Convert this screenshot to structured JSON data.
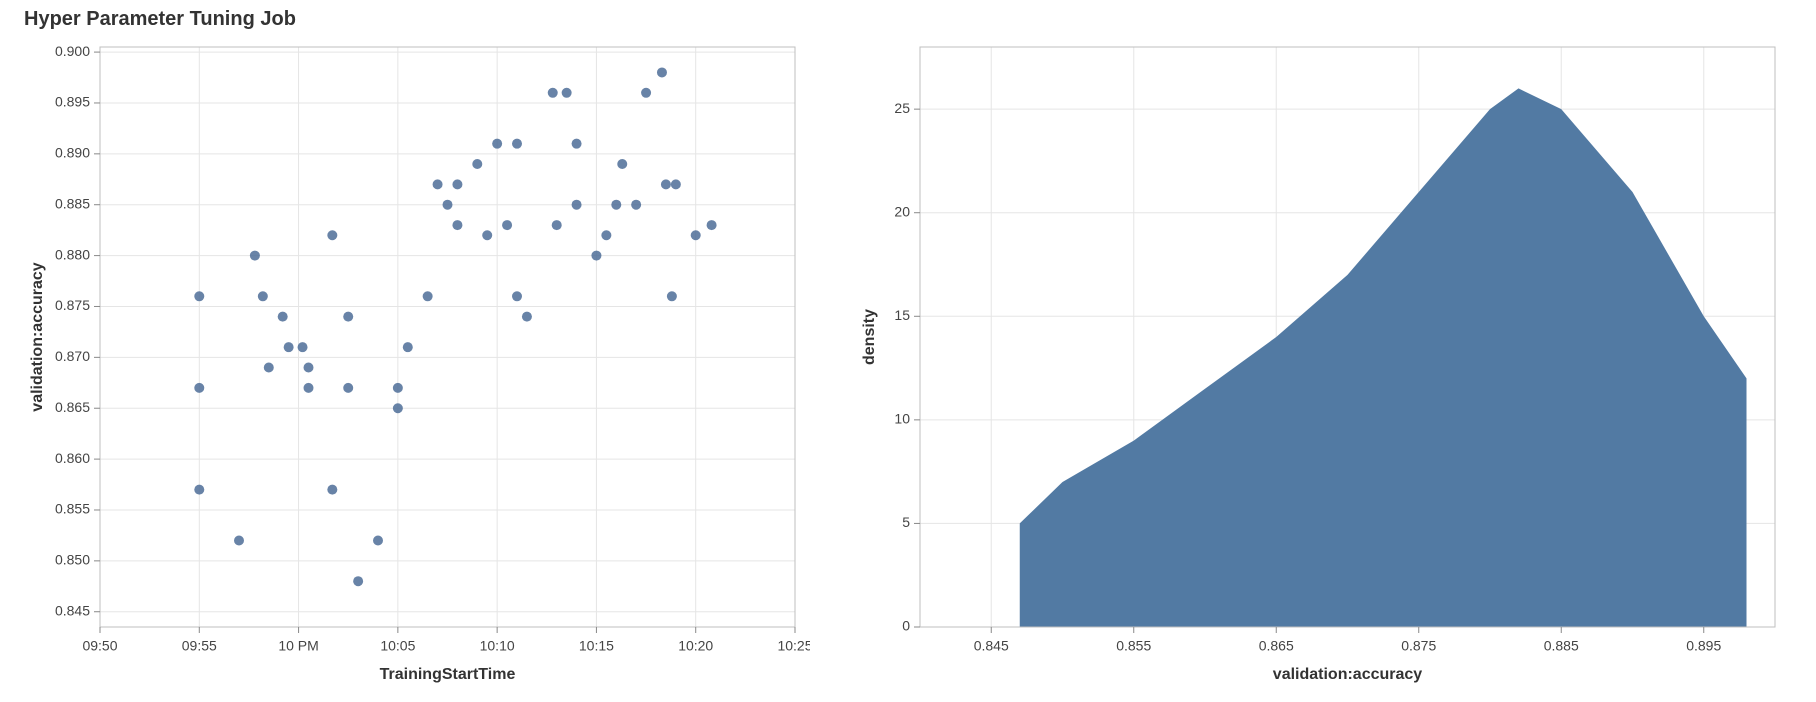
{
  "title": "Hyper Parameter Tuning Job",
  "colors": {
    "accent": "#527aa3",
    "dot": "#4d6d98"
  },
  "chart_data": [
    {
      "type": "scatter",
      "title": "Hyper Parameter Tuning Job",
      "xlabel": "TrainingStartTime",
      "ylabel": "validation:accuracy",
      "x_ticks_labels": [
        "09:50",
        "09:55",
        "10 PM",
        "10:05",
        "10:10",
        "10:15",
        "10:20",
        "10:25"
      ],
      "x_ticks_minutes": [
        -10,
        -5,
        0,
        5,
        10,
        15,
        20,
        25
      ],
      "xlim_minutes": [
        -10,
        25
      ],
      "y_ticks": [
        0.845,
        0.85,
        0.855,
        0.86,
        0.865,
        0.87,
        0.875,
        0.88,
        0.885,
        0.89,
        0.895,
        0.9
      ],
      "ylim": [
        0.8435,
        0.9005
      ],
      "points": [
        {
          "t": -5.0,
          "y": 0.876
        },
        {
          "t": -5.0,
          "y": 0.867
        },
        {
          "t": -5.0,
          "y": 0.857
        },
        {
          "t": -3.0,
          "y": 0.852
        },
        {
          "t": -2.2,
          "y": 0.88
        },
        {
          "t": -1.8,
          "y": 0.876
        },
        {
          "t": -1.5,
          "y": 0.869
        },
        {
          "t": -0.8,
          "y": 0.874
        },
        {
          "t": -0.5,
          "y": 0.871
        },
        {
          "t": 0.2,
          "y": 0.871
        },
        {
          "t": 0.5,
          "y": 0.867
        },
        {
          "t": 0.5,
          "y": 0.869
        },
        {
          "t": 1.7,
          "y": 0.882
        },
        {
          "t": 1.7,
          "y": 0.857
        },
        {
          "t": 2.5,
          "y": 0.867
        },
        {
          "t": 2.5,
          "y": 0.874
        },
        {
          "t": 3.0,
          "y": 0.848
        },
        {
          "t": 4.0,
          "y": 0.852
        },
        {
          "t": 5.0,
          "y": 0.867
        },
        {
          "t": 5.0,
          "y": 0.865
        },
        {
          "t": 5.5,
          "y": 0.871
        },
        {
          "t": 6.5,
          "y": 0.876
        },
        {
          "t": 7.0,
          "y": 0.887
        },
        {
          "t": 7.5,
          "y": 0.885
        },
        {
          "t": 8.0,
          "y": 0.887
        },
        {
          "t": 8.0,
          "y": 0.883
        },
        {
          "t": 9.0,
          "y": 0.889
        },
        {
          "t": 9.5,
          "y": 0.882
        },
        {
          "t": 10.0,
          "y": 0.891
        },
        {
          "t": 10.5,
          "y": 0.883
        },
        {
          "t": 11.0,
          "y": 0.891
        },
        {
          "t": 11.0,
          "y": 0.876
        },
        {
          "t": 11.5,
          "y": 0.874
        },
        {
          "t": 12.8,
          "y": 0.896
        },
        {
          "t": 13.0,
          "y": 0.883
        },
        {
          "t": 13.5,
          "y": 0.896
        },
        {
          "t": 14.0,
          "y": 0.885
        },
        {
          "t": 14.0,
          "y": 0.891
        },
        {
          "t": 15.0,
          "y": 0.88
        },
        {
          "t": 15.5,
          "y": 0.882
        },
        {
          "t": 16.0,
          "y": 0.885
        },
        {
          "t": 16.3,
          "y": 0.889
        },
        {
          "t": 17.0,
          "y": 0.885
        },
        {
          "t": 17.5,
          "y": 0.896
        },
        {
          "t": 18.3,
          "y": 0.898
        },
        {
          "t": 18.5,
          "y": 0.887
        },
        {
          "t": 18.8,
          "y": 0.876
        },
        {
          "t": 19.0,
          "y": 0.887
        },
        {
          "t": 20.0,
          "y": 0.882
        },
        {
          "t": 20.8,
          "y": 0.883
        }
      ]
    },
    {
      "type": "area",
      "xlabel": "validation:accuracy",
      "ylabel": "density",
      "x_ticks": [
        0.845,
        0.855,
        0.865,
        0.875,
        0.885,
        0.895
      ],
      "xlim": [
        0.84,
        0.9
      ],
      "y_ticks": [
        0,
        5,
        10,
        15,
        20,
        25
      ],
      "ylim": [
        0,
        28
      ],
      "series": [
        {
          "name": "density",
          "x": [
            0.847,
            0.85,
            0.855,
            0.86,
            0.865,
            0.87,
            0.875,
            0.88,
            0.882,
            0.885,
            0.89,
            0.895,
            0.898
          ],
          "values": [
            5,
            7,
            9,
            11.5,
            14,
            17,
            21,
            25,
            26,
            25,
            21,
            15,
            12
          ]
        }
      ]
    }
  ]
}
